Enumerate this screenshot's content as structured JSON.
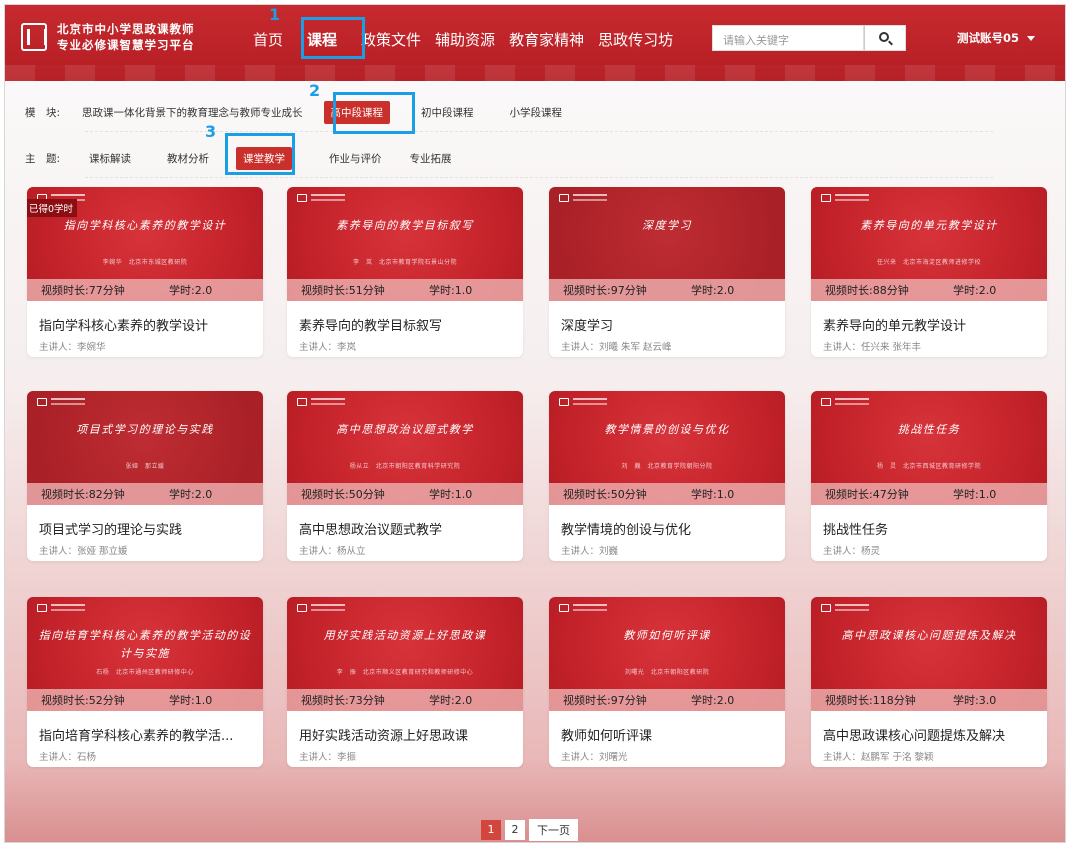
{
  "header": {
    "logo_line1": "北京市中小学思政课教师",
    "logo_line2": "专业必修课智慧学习平台",
    "nav": [
      "首页",
      "课程",
      "政策文件",
      "辅助资源",
      "教育家精神",
      "思政传习坊"
    ],
    "search_placeholder": "请输入关键字",
    "account": "测试账号05"
  },
  "annotations": [
    "1",
    "2",
    "3"
  ],
  "filters": {
    "module_label": "模　块:",
    "module_options": [
      "思政课一体化背景下的教育理念与教师专业成长",
      "高中段课程",
      "初中段课程",
      "小学段课程"
    ],
    "module_selected": 1,
    "topic_label": "主　题:",
    "topic_options": [
      "课标解读",
      "教材分析",
      "课堂教学",
      "作业与评价",
      "专业拓展"
    ],
    "topic_selected": 2
  },
  "cards": [
    {
      "thumb_title": "指向学科核心素养的教学设计",
      "thumb_sub": "李婉华　北京市东城区教研院",
      "duration": "视频时长:77分钟",
      "hours": "学时:2.0",
      "title": "指向学科核心素养的教学设计",
      "lecturer": "主讲人：李婉华",
      "badge": "已得0学时"
    },
    {
      "thumb_title": "素养导向的教学目标叙写",
      "thumb_sub": "李　岚　北京市教育学院石景山分院",
      "duration": "视频时长:51分钟",
      "hours": "学时:1.0",
      "title": "素养导向的教学目标叙写",
      "lecturer": "主讲人：李岚"
    },
    {
      "thumb_title": "深度学习",
      "thumb_sub": "",
      "duration": "视频时长:97分钟",
      "hours": "学时:2.0",
      "title": "深度学习",
      "lecturer": "主讲人：刘曦 朱军 赵云峰"
    },
    {
      "thumb_title": "素养导向的单元教学设计",
      "thumb_sub": "任兴来　北京市海淀区教师进修学校",
      "duration": "视频时长:88分钟",
      "hours": "学时:2.0",
      "title": "素养导向的单元教学设计",
      "lecturer": "主讲人：任兴来 张年丰"
    },
    {
      "thumb_title": "项目式学习的理论与实践",
      "thumb_sub": "张娅　那立媛",
      "duration": "视频时长:82分钟",
      "hours": "学时:2.0",
      "title": "项目式学习的理论与实践",
      "lecturer": "主讲人：张娅 那立媛"
    },
    {
      "thumb_title": "高中思想政治议题式教学",
      "thumb_sub": "杨从立　北京市朝阳区教育科学研究院",
      "duration": "视频时长:50分钟",
      "hours": "学时:1.0",
      "title": "高中思想政治议题式教学",
      "lecturer": "主讲人：杨从立"
    },
    {
      "thumb_title": "教学情景的创设与优化",
      "thumb_sub": "刘　巍　北京教育学院朝阳分院",
      "duration": "视频时长:50分钟",
      "hours": "学时:1.0",
      "title": "教学情境的创设与优化",
      "lecturer": "主讲人：刘巍"
    },
    {
      "thumb_title": "挑战性任务",
      "thumb_sub": "杨　灵　北京市西城区教育研修学院",
      "duration": "视频时长:47分钟",
      "hours": "学时:1.0",
      "title": "挑战性任务",
      "lecturer": "主讲人：杨灵"
    },
    {
      "thumb_title": "指向培育学科核心素养的教学活动的设计与实施",
      "thumb_sub": "石杨　北京市通州区教师研修中心",
      "duration": "视频时长:52分钟",
      "hours": "学时:1.0",
      "title": "指向培育学科核心素养的教学活...",
      "lecturer": "主讲人：石杨"
    },
    {
      "thumb_title": "用好实践活动资源上好思政课",
      "thumb_sub": "李　振　北京市顺义区教育研究和教师研修中心",
      "duration": "视频时长:73分钟",
      "hours": "学时:2.0",
      "title": "用好实践活动资源上好思政课",
      "lecturer": "主讲人：李振"
    },
    {
      "thumb_title": "教师如何听评课",
      "thumb_sub": "刘曙光　北京市朝阳区教研院",
      "duration": "视频时长:97分钟",
      "hours": "学时:2.0",
      "title": "教师如何听评课",
      "lecturer": "主讲人：刘曙光"
    },
    {
      "thumb_title": "高中思政课核心问题提炼及解决",
      "thumb_sub": "",
      "duration": "视频时长:118分钟",
      "hours": "学时:3.0",
      "title": "高中思政课核心问题提炼及解决",
      "lecturer": "主讲人：赵鹏军 于洺 黎颖"
    }
  ],
  "pagination": {
    "pages": [
      "1",
      "2"
    ],
    "current": "1",
    "next": "下一页"
  }
}
